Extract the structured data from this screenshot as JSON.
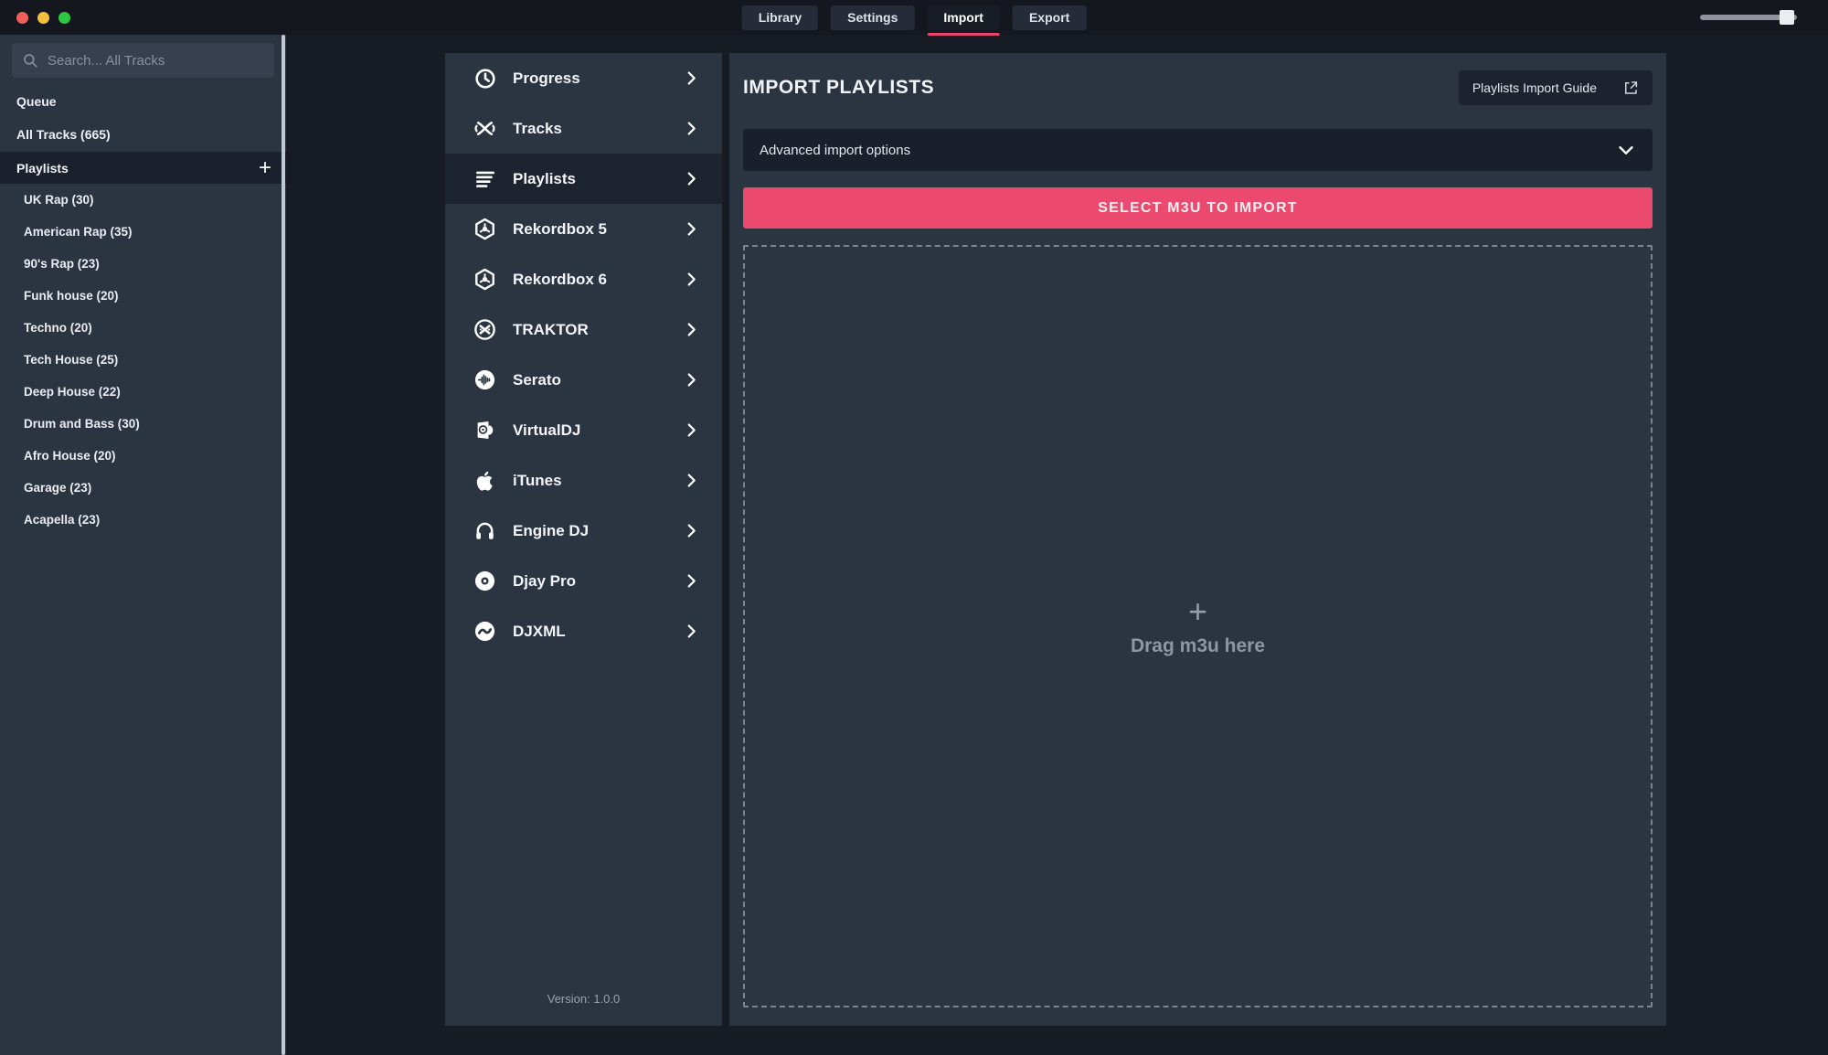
{
  "titlebar": {
    "tabs": [
      {
        "label": "Library",
        "active": false
      },
      {
        "label": "Settings",
        "active": false
      },
      {
        "label": "Import",
        "active": true
      },
      {
        "label": "Export",
        "active": false
      }
    ]
  },
  "sidebar": {
    "search_placeholder": "Search... All Tracks",
    "queue_label": "Queue",
    "all_tracks_label": "All Tracks (665)",
    "playlists_header": "Playlists",
    "add_button": "+",
    "playlists": [
      "UK Rap (30)",
      "American Rap (35)",
      "90's Rap (23)",
      "Funk house (20)",
      "Techno (20)",
      "Tech House (25)",
      "Deep House (22)",
      "Drum and Bass (30)",
      "Afro House (20)",
      "Garage (23)",
      "Acapella (23)"
    ]
  },
  "menu": {
    "items": [
      {
        "label": "Progress",
        "icon": "clock-icon",
        "selected": false
      },
      {
        "label": "Tracks",
        "icon": "tracks-icon",
        "selected": false
      },
      {
        "label": "Playlists",
        "icon": "playlist-icon",
        "selected": true
      },
      {
        "label": "Rekordbox 5",
        "icon": "rekordbox-icon",
        "selected": false
      },
      {
        "label": "Rekordbox 6",
        "icon": "rekordbox-icon",
        "selected": false
      },
      {
        "label": "TRAKTOR",
        "icon": "traktor-icon",
        "selected": false
      },
      {
        "label": "Serato",
        "icon": "serato-icon",
        "selected": false
      },
      {
        "label": "VirtualDJ",
        "icon": "virtualdj-icon",
        "selected": false
      },
      {
        "label": "iTunes",
        "icon": "apple-icon",
        "selected": false
      },
      {
        "label": "Engine DJ",
        "icon": "headphones-icon",
        "selected": false
      },
      {
        "label": "Djay Pro",
        "icon": "disc-icon",
        "selected": false
      },
      {
        "label": "DJXML",
        "icon": "wave-icon",
        "selected": false
      }
    ],
    "version": "Version: 1.0.0"
  },
  "main": {
    "title": "IMPORT PLAYLISTS",
    "guide_button": "Playlists Import Guide",
    "advanced_options": "Advanced import options",
    "select_button": "SELECT M3U TO IMPORT",
    "dropzone_plus": "+",
    "dropzone_label": "Drag m3u here"
  },
  "colors": {
    "accent_pink": "#e9446d",
    "button_pink": "#eb4a6e",
    "panel": "#2b3441",
    "panel_dark": "#1a202b",
    "background": "#171b23",
    "topbar": "#14171e"
  }
}
